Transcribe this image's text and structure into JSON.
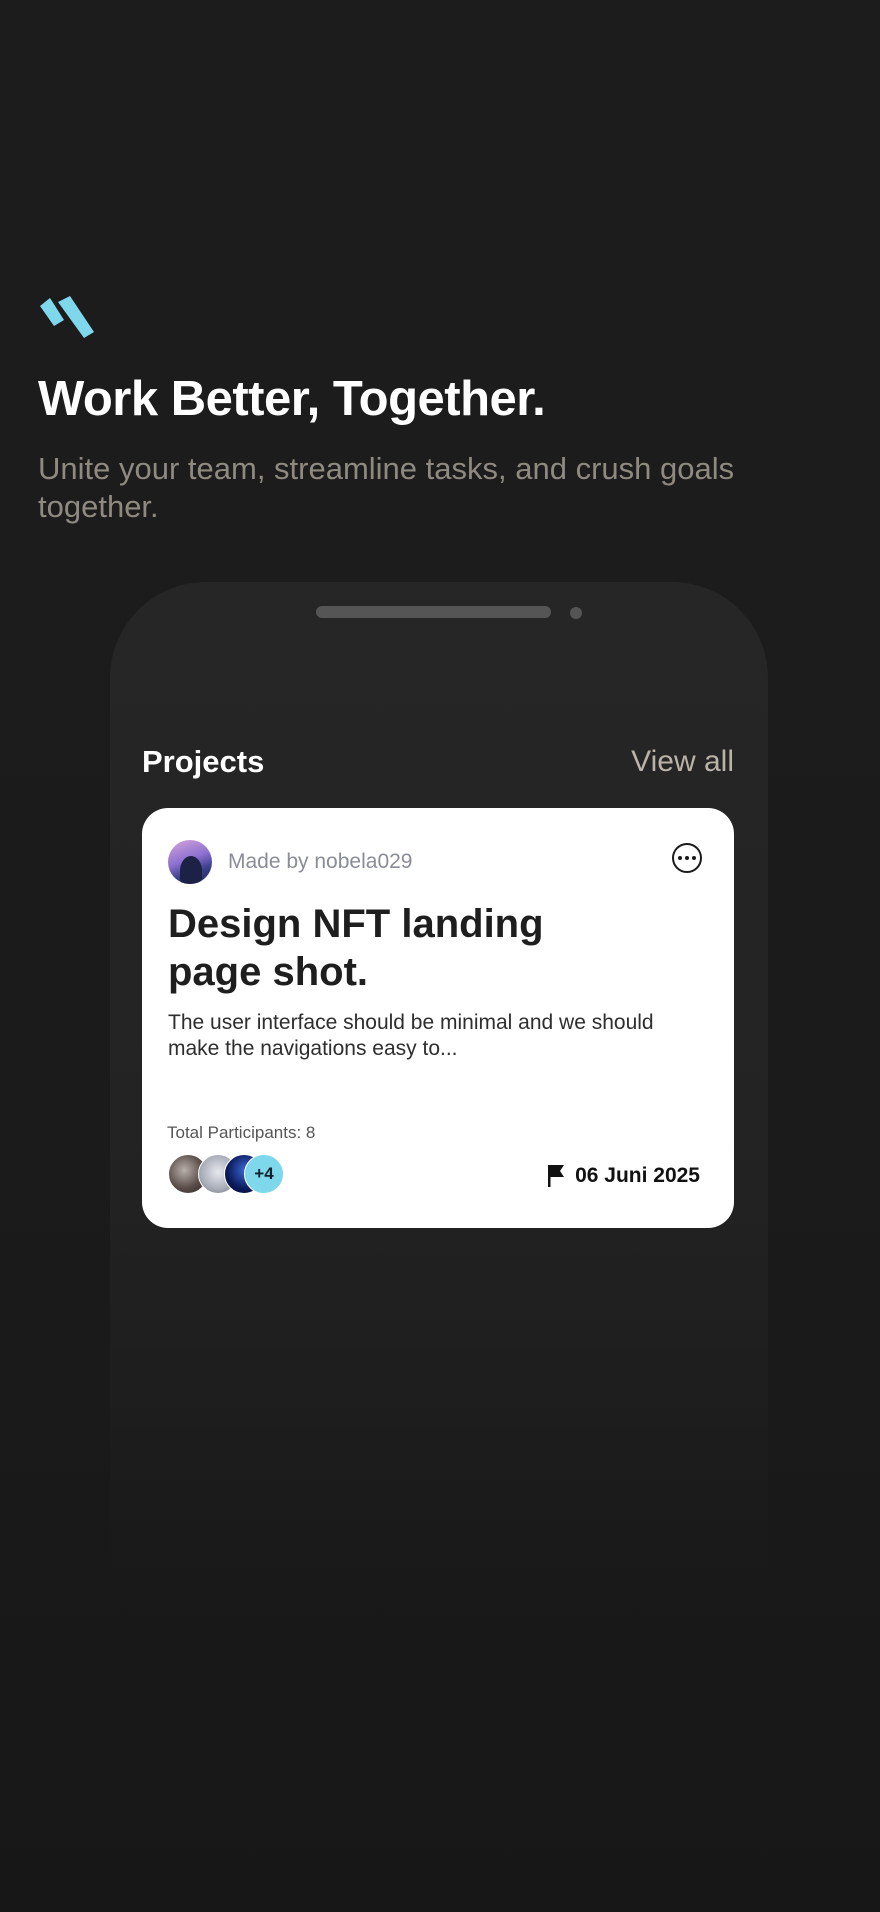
{
  "hero": {
    "logo_icon": "double-slash-logo-icon",
    "accent_color": "#7fd7ec",
    "headline": "Work Better, Together.",
    "subhead": "Unite your team, streamline tasks, and crush goals together."
  },
  "projects_section": {
    "title": "Projects",
    "view_all_label": "View all"
  },
  "project_card": {
    "author_label": "Made by nobela029",
    "more_icon": "more-horizontal-circle-icon",
    "title": "Design NFT landing page shot.",
    "description": "The user interface should be minimal and we should make the navigations easy to...",
    "participants_label": "Total Participants: 8",
    "extra_participants": "+4",
    "flag_icon": "flag-icon",
    "due_date": "06 Juni 2025"
  }
}
